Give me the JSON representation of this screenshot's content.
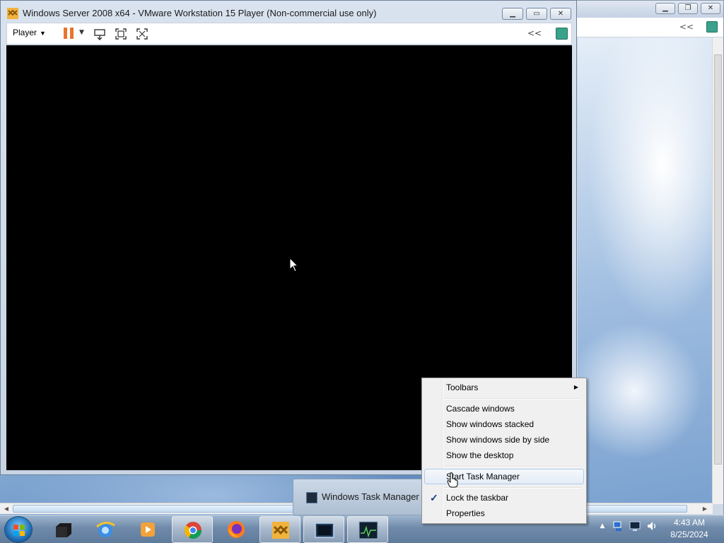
{
  "vm_window": {
    "title": "Windows Server 2008 x64 - VMware Workstation 15 Player (Non-commercial use only)",
    "player_menu_label": "Player",
    "collapse_label": "<<"
  },
  "bg_window": {
    "collapse_label": "<<"
  },
  "context_menu": {
    "items": [
      {
        "label": "Toolbars"
      },
      {
        "label": "Cascade windows"
      },
      {
        "label": "Show windows stacked"
      },
      {
        "label": "Show windows side by side"
      },
      {
        "label": "Show the desktop"
      },
      {
        "label": "Start Task Manager"
      },
      {
        "label": "Lock the taskbar",
        "checked": true
      },
      {
        "label": "Properties"
      }
    ]
  },
  "taskbar": {
    "thumbnail_label": "Windows Task Manager",
    "pinned": [
      "server-manager-icon",
      "internet-explorer-icon",
      "media-player-icon",
      "chrome-icon",
      "firefox-icon",
      "vmware-icon",
      "remote-desktop-icon",
      "task-manager-icon"
    ],
    "clock_time": "4:43 AM",
    "clock_date": "8/25/2024"
  },
  "colors": {
    "accent_orange": "#e8752d",
    "note_green": "#3aa28a",
    "menu_hover_border": "#aecbf0"
  }
}
